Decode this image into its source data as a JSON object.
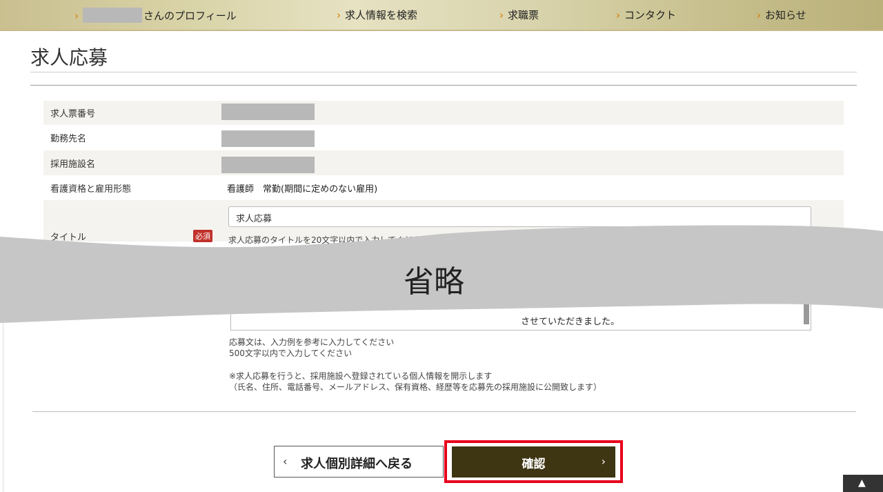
{
  "nav": {
    "profile_suffix": "さんのプロフィール",
    "search": "求人情報を検索",
    "jobcard": "求職票",
    "contact": "コンタクト",
    "news": "お知らせ"
  },
  "page": {
    "title": "求人応募"
  },
  "form": {
    "job_number_label": "求人票番号",
    "workplace_label": "勤務先名",
    "facility_label": "採用施設名",
    "qualification_label": "看護資格と雇用形態",
    "qualification_value": "看護師　常勤(期間に定めのない雇用)",
    "title_label": "タイトル",
    "required_badge": "必須",
    "title_value": "求人応募",
    "title_help": "求人応募のタイトルを20文字以内で入力してください",
    "omitted": "省略",
    "message_text_fragment": "させていただきました。",
    "note1": "応募文は、入力例を参考に入力してください",
    "note2": "500文字以内で入力してください",
    "note3": "※求人応募を行うと、採用施設へ登録されている個人情報を開示します",
    "note4": "（氏名、住所、電話番号、メールアドレス、保有資格、経歴等を応募先の採用施設に公開致します）"
  },
  "buttons": {
    "back": "求人個別詳細へ戻る",
    "confirm": "確認"
  },
  "colors": {
    "confirm_bg": "#3e3512",
    "highlight": "#e8001b",
    "required": "#c0302a"
  }
}
